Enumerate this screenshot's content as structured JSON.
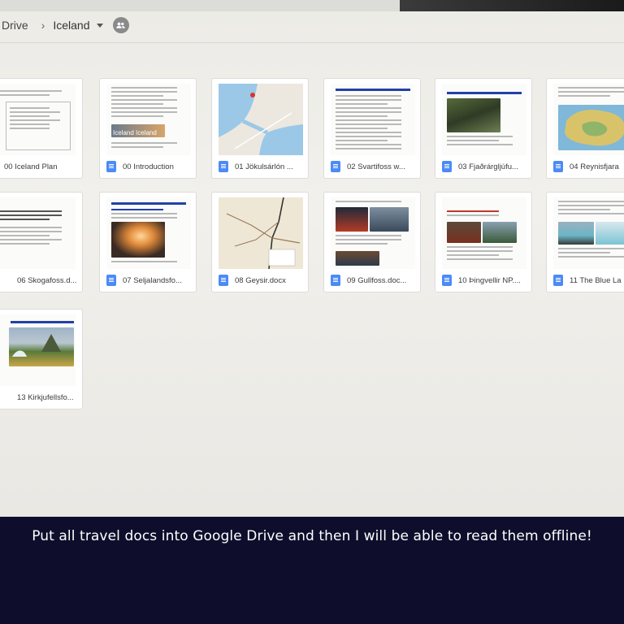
{
  "breadcrumb": {
    "root": "Drive",
    "separator": "›",
    "current": "Iceland"
  },
  "icons": {
    "shared": "shared-people-icon",
    "doc": "google-docs-icon",
    "dropdown": "caret-down-icon"
  },
  "colors": {
    "docs_blue": "#4c8bf5",
    "caption_bg": "#0e0e2c",
    "caption_text": "#ffffff"
  },
  "files": [
    {
      "name": "00 Iceland Plan",
      "has_icon": false
    },
    {
      "name": "00 Introduction",
      "has_icon": true
    },
    {
      "name": "01 Jökulsárlón ...",
      "has_icon": true
    },
    {
      "name": "02 Svartifoss w...",
      "has_icon": true
    },
    {
      "name": "03 Fjaðrárgljúfu...",
      "has_icon": true
    },
    {
      "name": "04 Reynisfjara",
      "has_icon": true
    },
    {
      "name": "06 Skogafoss.d...",
      "has_icon": false
    },
    {
      "name": "07 Seljalandsfo...",
      "has_icon": true
    },
    {
      "name": "08 Geysir.docx",
      "has_icon": true
    },
    {
      "name": "09 Gullfoss.doc...",
      "has_icon": true
    },
    {
      "name": "10 Þingvellir NP....",
      "has_icon": true
    },
    {
      "name": "11 The Blue La",
      "has_icon": true
    },
    {
      "name": "13 Kirkjufellsfo...",
      "has_icon": false
    }
  ],
  "thumb_text": {
    "intro_banner": "Iceland Iceland"
  },
  "caption": "Put all travel docs into Google Drive and then I will be able to read them offline!"
}
